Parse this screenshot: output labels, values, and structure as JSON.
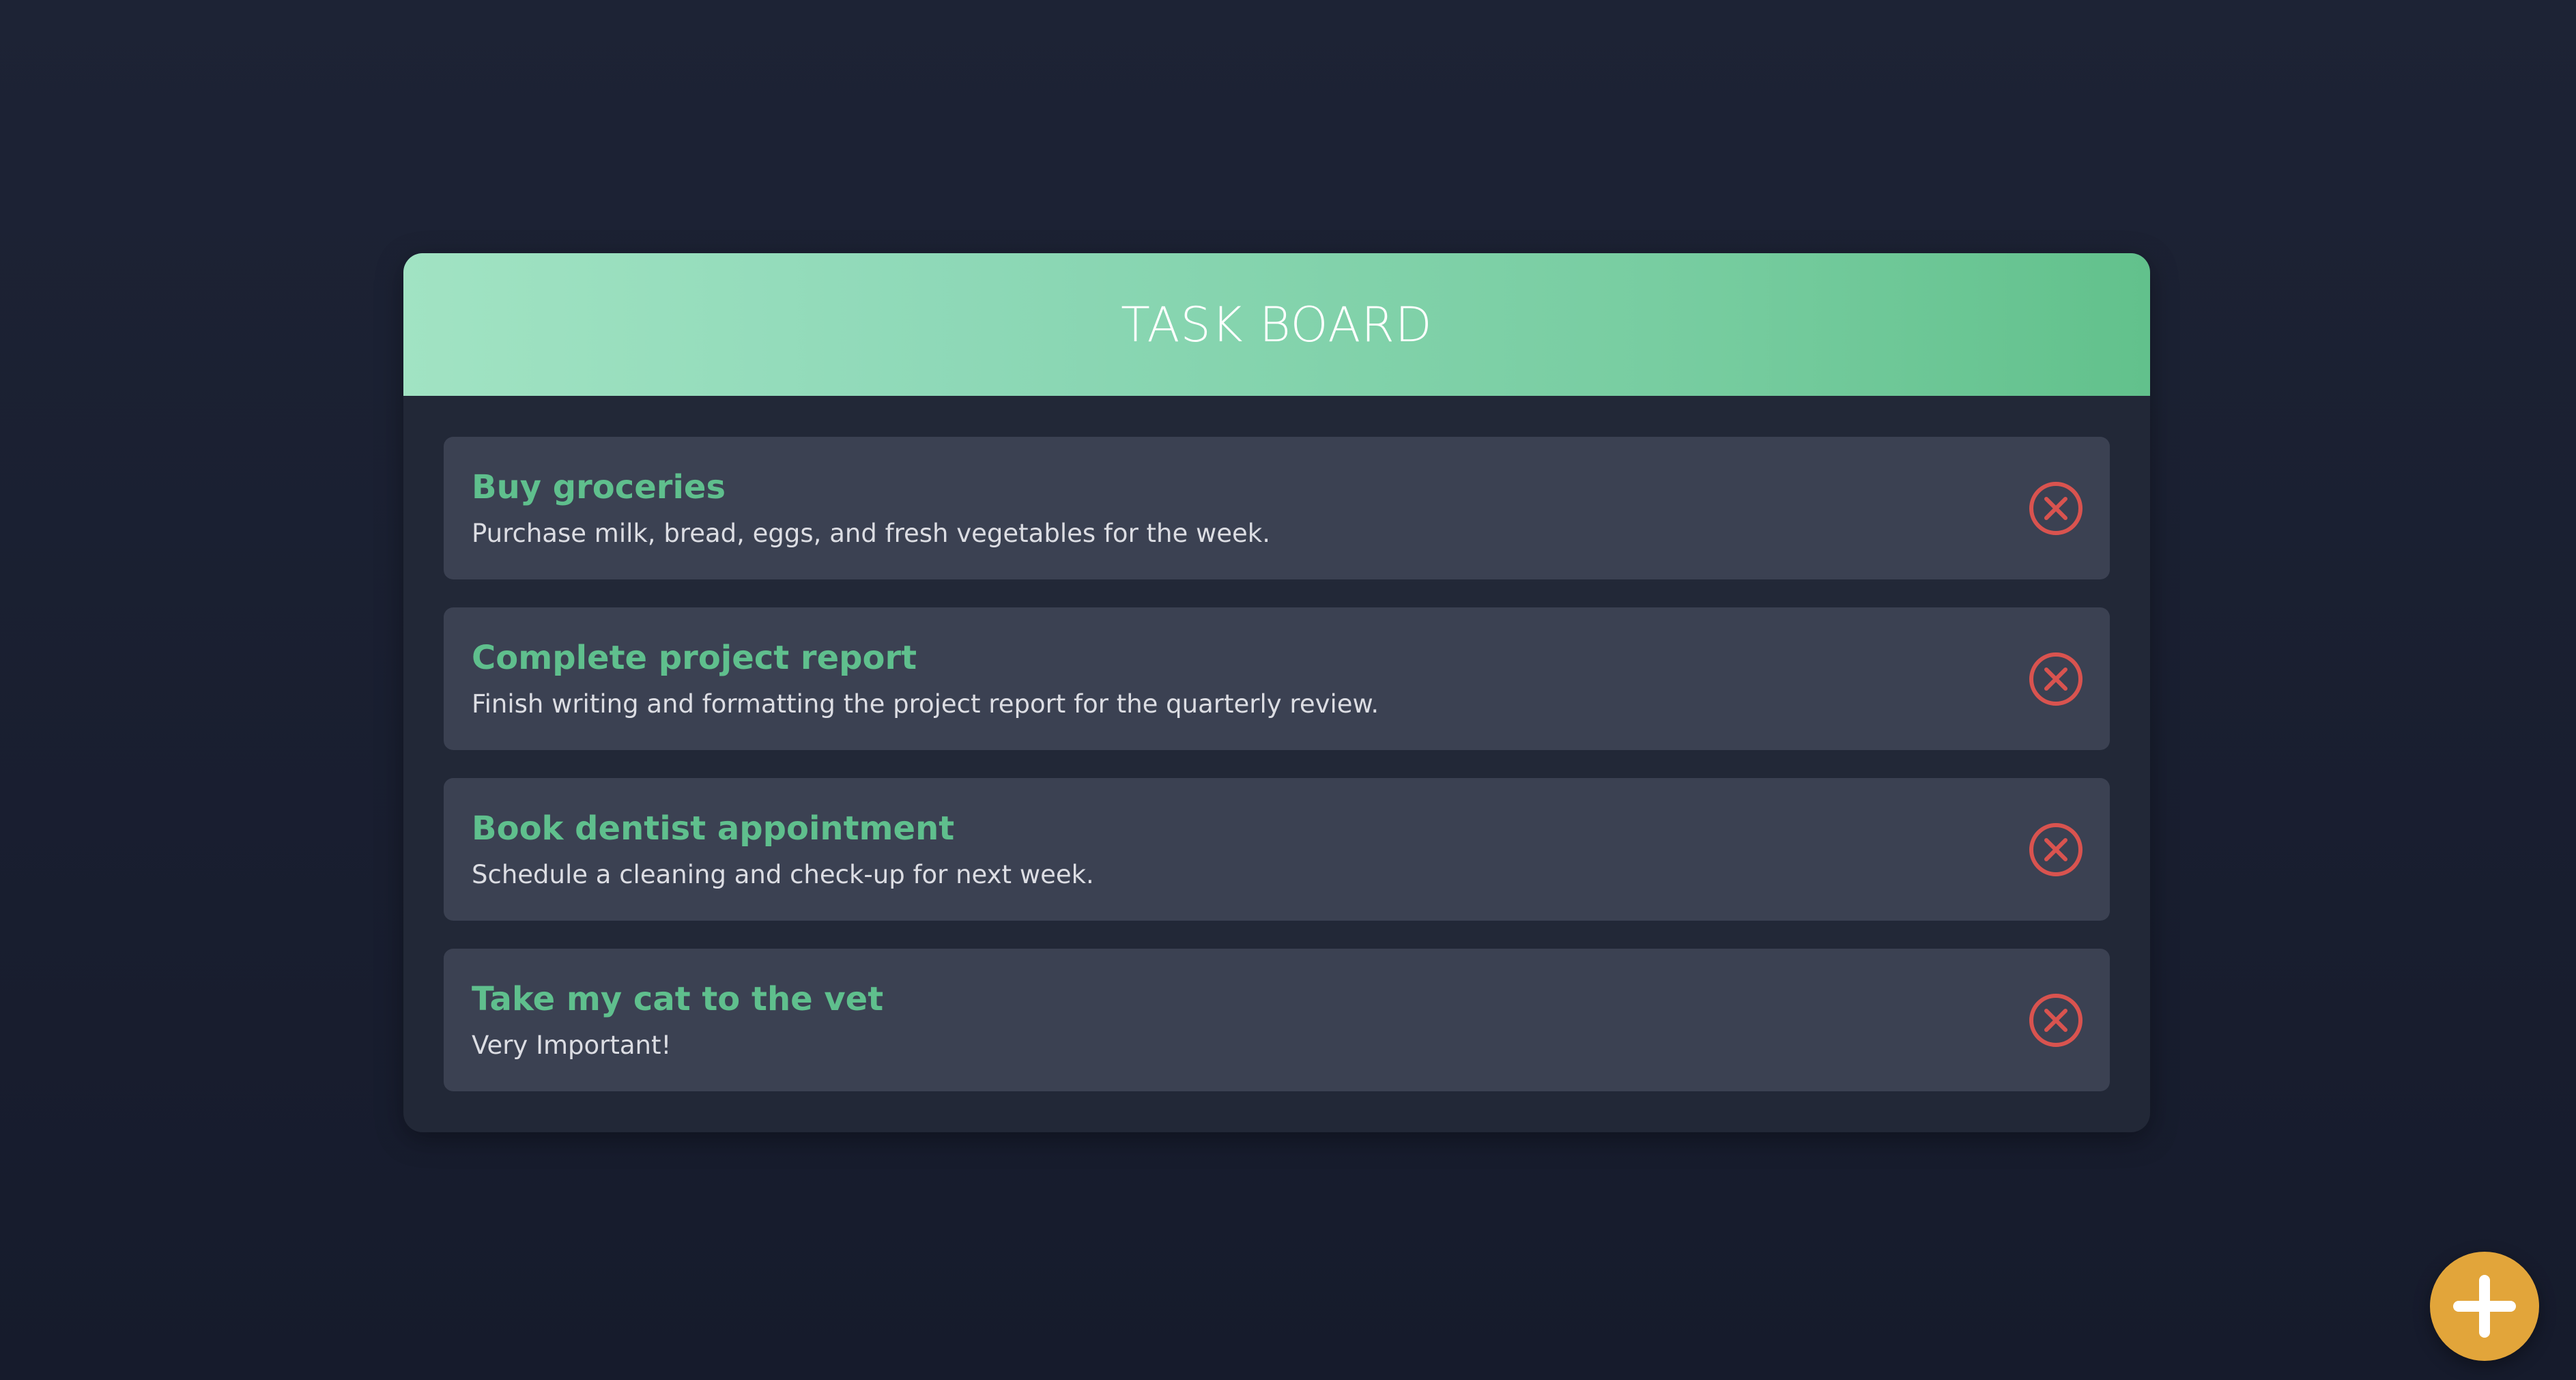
{
  "board": {
    "title": "TASK BOARD"
  },
  "tasks": [
    {
      "title": "Buy groceries",
      "description": "Purchase milk, bread, eggs, and fresh vegetables for the week."
    },
    {
      "title": "Complete project report",
      "description": "Finish writing and formatting the project report for the quarterly review."
    },
    {
      "title": "Book dentist appointment",
      "description": "Schedule a cleaning and check-up for next week."
    },
    {
      "title": "Take my cat to the vet",
      "description": "Very Important!"
    }
  ],
  "icons": {
    "delete": "close-circle-icon",
    "add": "plus-icon"
  },
  "colors": {
    "accent_green": "#5fbf8d",
    "delete_red": "#d9534f",
    "fab_gold": "#e2a53a",
    "card_bg": "#3b4152",
    "panel_bg": "#222837"
  }
}
